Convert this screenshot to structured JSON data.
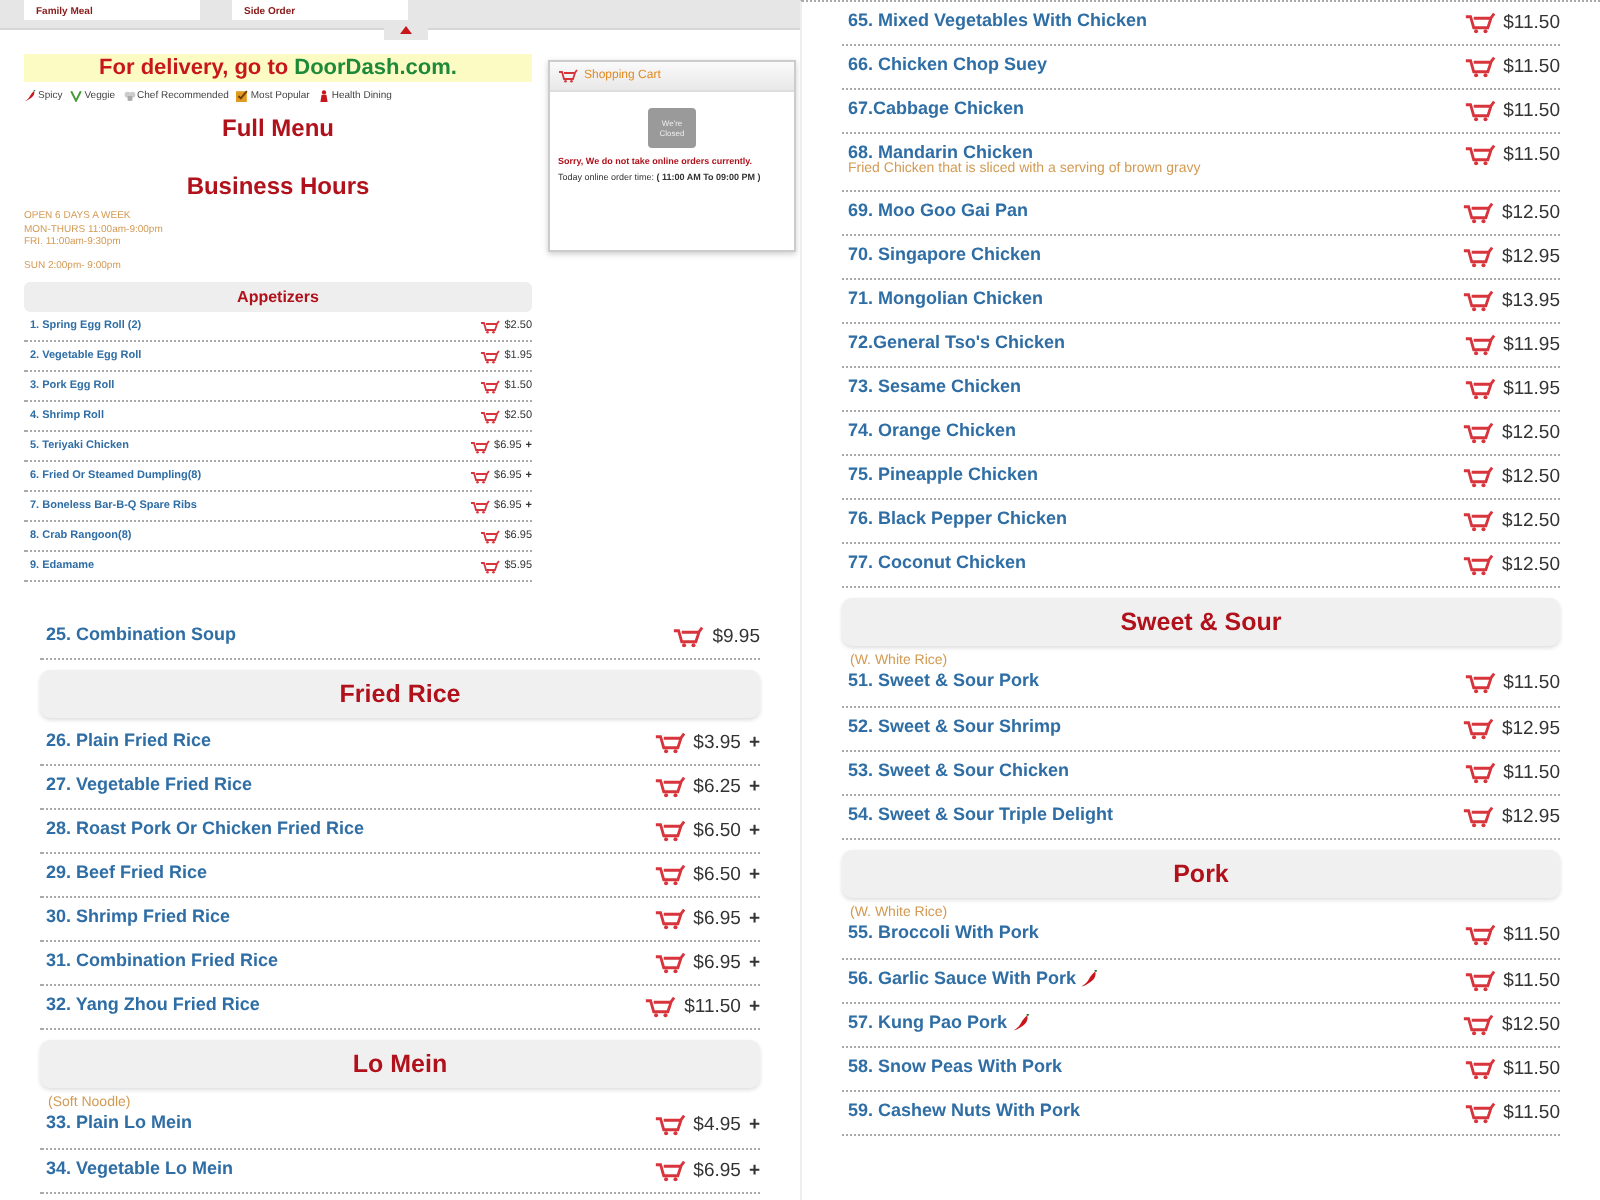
{
  "top_panel": {
    "nav_items": [
      "Family Meal",
      "Side Order"
    ],
    "delivery_banner": {
      "text": "For delivery, go to ",
      "link": "DoorDash.com."
    },
    "legend": [
      {
        "kind": "spicy",
        "label": "Spicy"
      },
      {
        "kind": "veggie",
        "label": "Veggie"
      },
      {
        "kind": "chef",
        "label": "Chef Recommended"
      },
      {
        "kind": "popular",
        "label": "Most Popular"
      },
      {
        "kind": "health",
        "label": "Health Dining"
      }
    ],
    "title": "Full Menu",
    "hours_title": "Business Hours",
    "hours": [
      [
        "OPEN  6 DAYS  A WEEK",
        "MON-THURS 11:00am-9:00pm",
        "FRI. 11:00am-9:30pm"
      ],
      [
        "SUN 2:00pm- 9:00pm"
      ]
    ],
    "cart": {
      "title": "Shopping Cart",
      "sign": [
        "We're",
        "Closed"
      ],
      "message": "Sorry, We do not take online orders currently.",
      "order_time": "Today online order time: **( 11:00 AM  To  09:00 PM )**"
    },
    "section": {
      "title": "Appetizers",
      "items": [
        {
          "name": "1. Spring Egg Roll (2)",
          "price": "$2.50"
        },
        {
          "name": "2. Vegetable Egg Roll",
          "price": "$1.95"
        },
        {
          "name": "3. Pork Egg Roll",
          "price": "$1.50"
        },
        {
          "name": "4. Shrimp Roll",
          "price": "$2.50"
        },
        {
          "name": "5. Teriyaki Chicken",
          "price": "$6.95",
          "plus": "+"
        },
        {
          "name": "6. Fried Or Steamed Dumpling(8)",
          "price": "$6.95",
          "plus": "+"
        },
        {
          "name": "7. Boneless Bar-B-Q Spare Ribs",
          "price": "$6.95",
          "plus": "+"
        },
        {
          "name": "8. Crab Rangoon(8)",
          "price": "$6.95"
        },
        {
          "name": "9. Edamame",
          "price": "$5.95"
        }
      ]
    }
  },
  "left_panel": {
    "sections": [
      {
        "items": [
          {
            "name": "25. Combination Soup",
            "price": "$9.95"
          }
        ]
      },
      {
        "title": "Fried Rice",
        "items": [
          {
            "name": "26. Plain Fried Rice",
            "price": "$3.95",
            "plus": "+"
          },
          {
            "name": "27. Vegetable Fried Rice",
            "price": "$6.25",
            "plus": "+"
          },
          {
            "name": "28. Roast Pork Or Chicken Fried Rice",
            "price": "$6.50",
            "plus": "+"
          },
          {
            "name": "29. Beef Fried Rice",
            "price": "$6.50",
            "plus": "+"
          },
          {
            "name": "30. Shrimp Fried Rice",
            "price": "$6.95",
            "plus": "+"
          },
          {
            "name": "31. Combination Fried Rice",
            "price": "$6.95",
            "plus": "+"
          },
          {
            "name": "32. Yang Zhou Fried Rice",
            "price": "$11.50",
            "plus": "+"
          }
        ]
      },
      {
        "title": "Lo Mein",
        "note": "(Soft Noodle)",
        "items": [
          {
            "name": "33. Plain Lo Mein",
            "price": "$4.95",
            "plus": "+"
          },
          {
            "name": "34. Vegetable Lo Mein",
            "price": "$6.95",
            "plus": "+"
          }
        ]
      }
    ]
  },
  "right_panel": {
    "sections": [
      {
        "items": [
          {
            "name": "65. Mixed Vegetables With Chicken",
            "price": "$11.50"
          },
          {
            "name": "66. Chicken Chop Suey",
            "price": "$11.50"
          },
          {
            "name": "67.Cabbage Chicken",
            "price": "$11.50"
          },
          {
            "name": "68. Mandarin Chicken",
            "description": "Fried Chicken that is sliced with a serving of brown gravy",
            "price": "$11.50"
          },
          {
            "name": "69. Moo Goo Gai Pan",
            "price": "$12.50"
          },
          {
            "name": "70. Singapore Chicken",
            "price": "$12.95"
          },
          {
            "name": "71. Mongolian Chicken",
            "price": "$13.95"
          },
          {
            "name": "72.General Tso's Chicken",
            "price": "$11.95"
          },
          {
            "name": "73. Sesame Chicken",
            "price": "$11.95"
          },
          {
            "name": "74. Orange Chicken",
            "price": "$12.50"
          },
          {
            "name": "75. Pineapple Chicken",
            "price": "$12.50"
          },
          {
            "name": "76. Black Pepper Chicken",
            "price": "$12.50"
          },
          {
            "name": "77. Coconut Chicken",
            "price": "$12.50"
          }
        ]
      },
      {
        "title": "Sweet & Sour",
        "note": "(W. White Rice)",
        "items": [
          {
            "name": "51. Sweet & Sour Pork",
            "price": "$11.50"
          },
          {
            "name": "52. Sweet & Sour Shrimp",
            "price": "$12.95"
          },
          {
            "name": "53. Sweet & Sour Chicken",
            "price": "$11.50"
          },
          {
            "name": "54. Sweet & Sour Triple Delight",
            "price": "$12.95"
          }
        ]
      },
      {
        "title": "Pork",
        "note": "(W. White Rice)",
        "items": [
          {
            "name": "55. Broccoli With Pork",
            "price": "$11.50",
            "spicy": false
          },
          {
            "name": "56. Garlic Sauce With Pork",
            "price": "$11.50",
            "spicy": true
          },
          {
            "name": "57. Kung Pao Pork",
            "price": "$12.50",
            "spicy": true
          },
          {
            "name": "58. Snow Peas With Pork",
            "price": "$11.50",
            "spicy": false
          },
          {
            "name": "59. Cashew Nuts With Pork",
            "price": "$11.50",
            "spicy": false
          }
        ]
      }
    ]
  }
}
